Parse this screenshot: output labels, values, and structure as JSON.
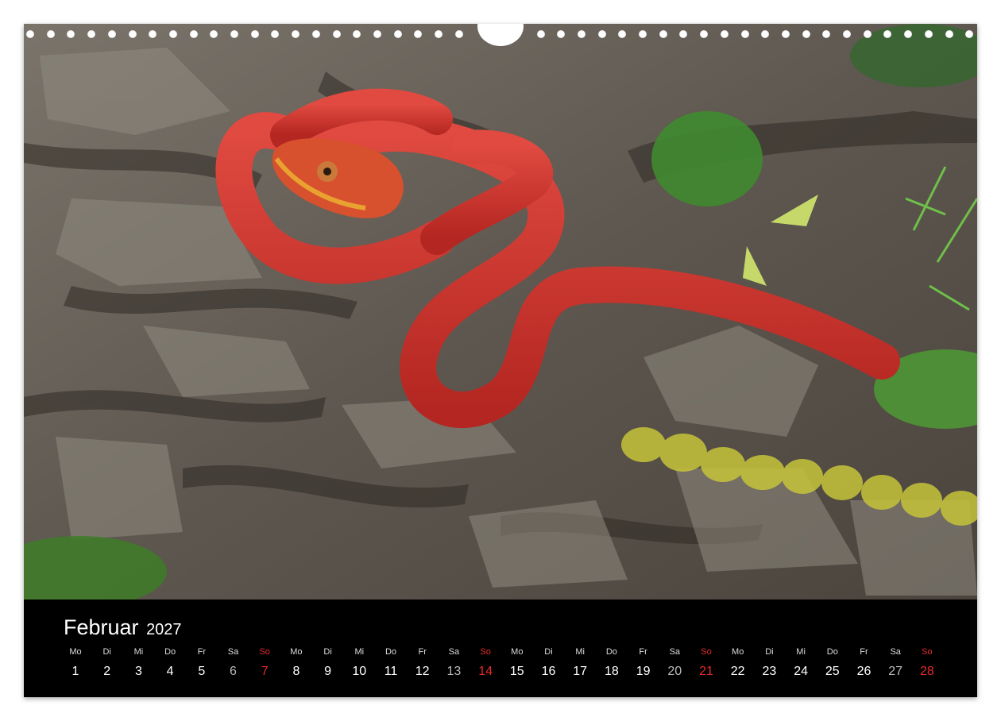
{
  "month": "Februar",
  "year": "2027",
  "weekday_abbr": [
    "Mo",
    "Di",
    "Mi",
    "Do",
    "Fr",
    "Sa",
    "So"
  ],
  "first_weekday_index": 0,
  "days_in_month": 28,
  "colors": {
    "background": "#000000",
    "text": "#ffffff",
    "sunday": "#e52a2a",
    "snake": "#c8302c"
  },
  "days": [
    {
      "wd": "Mo",
      "d": "1"
    },
    {
      "wd": "Di",
      "d": "2"
    },
    {
      "wd": "Mi",
      "d": "3"
    },
    {
      "wd": "Do",
      "d": "4"
    },
    {
      "wd": "Fr",
      "d": "5"
    },
    {
      "wd": "Sa",
      "d": "6"
    },
    {
      "wd": "So",
      "d": "7"
    },
    {
      "wd": "Mo",
      "d": "8"
    },
    {
      "wd": "Di",
      "d": "9"
    },
    {
      "wd": "Mi",
      "d": "10"
    },
    {
      "wd": "Do",
      "d": "11"
    },
    {
      "wd": "Fr",
      "d": "12"
    },
    {
      "wd": "Sa",
      "d": "13"
    },
    {
      "wd": "So",
      "d": "14"
    },
    {
      "wd": "Mo",
      "d": "15"
    },
    {
      "wd": "Di",
      "d": "16"
    },
    {
      "wd": "Mi",
      "d": "17"
    },
    {
      "wd": "Do",
      "d": "18"
    },
    {
      "wd": "Fr",
      "d": "19"
    },
    {
      "wd": "Sa",
      "d": "20"
    },
    {
      "wd": "So",
      "d": "21"
    },
    {
      "wd": "Mo",
      "d": "22"
    },
    {
      "wd": "Di",
      "d": "23"
    },
    {
      "wd": "Mi",
      "d": "24"
    },
    {
      "wd": "Do",
      "d": "25"
    },
    {
      "wd": "Fr",
      "d": "26"
    },
    {
      "wd": "Sa",
      "d": "27"
    },
    {
      "wd": "So",
      "d": "28"
    }
  ]
}
